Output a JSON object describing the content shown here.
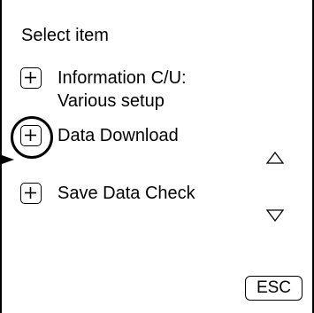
{
  "header": {
    "title": "Select item"
  },
  "menu": {
    "items": [
      {
        "label_lines": [
          "Information C/U:",
          "Various setup"
        ],
        "icon": "plus-icon"
      },
      {
        "label_lines": [
          "Data Download"
        ],
        "icon": "plus-icon",
        "highlighted": true
      },
      {
        "label_lines": [
          "Save Data Check"
        ],
        "icon": "plus-icon"
      }
    ]
  },
  "scroll": {
    "up_icon": "triangle-up-icon",
    "down_icon": "triangle-down-icon"
  },
  "footer": {
    "esc_label": "ESC"
  }
}
